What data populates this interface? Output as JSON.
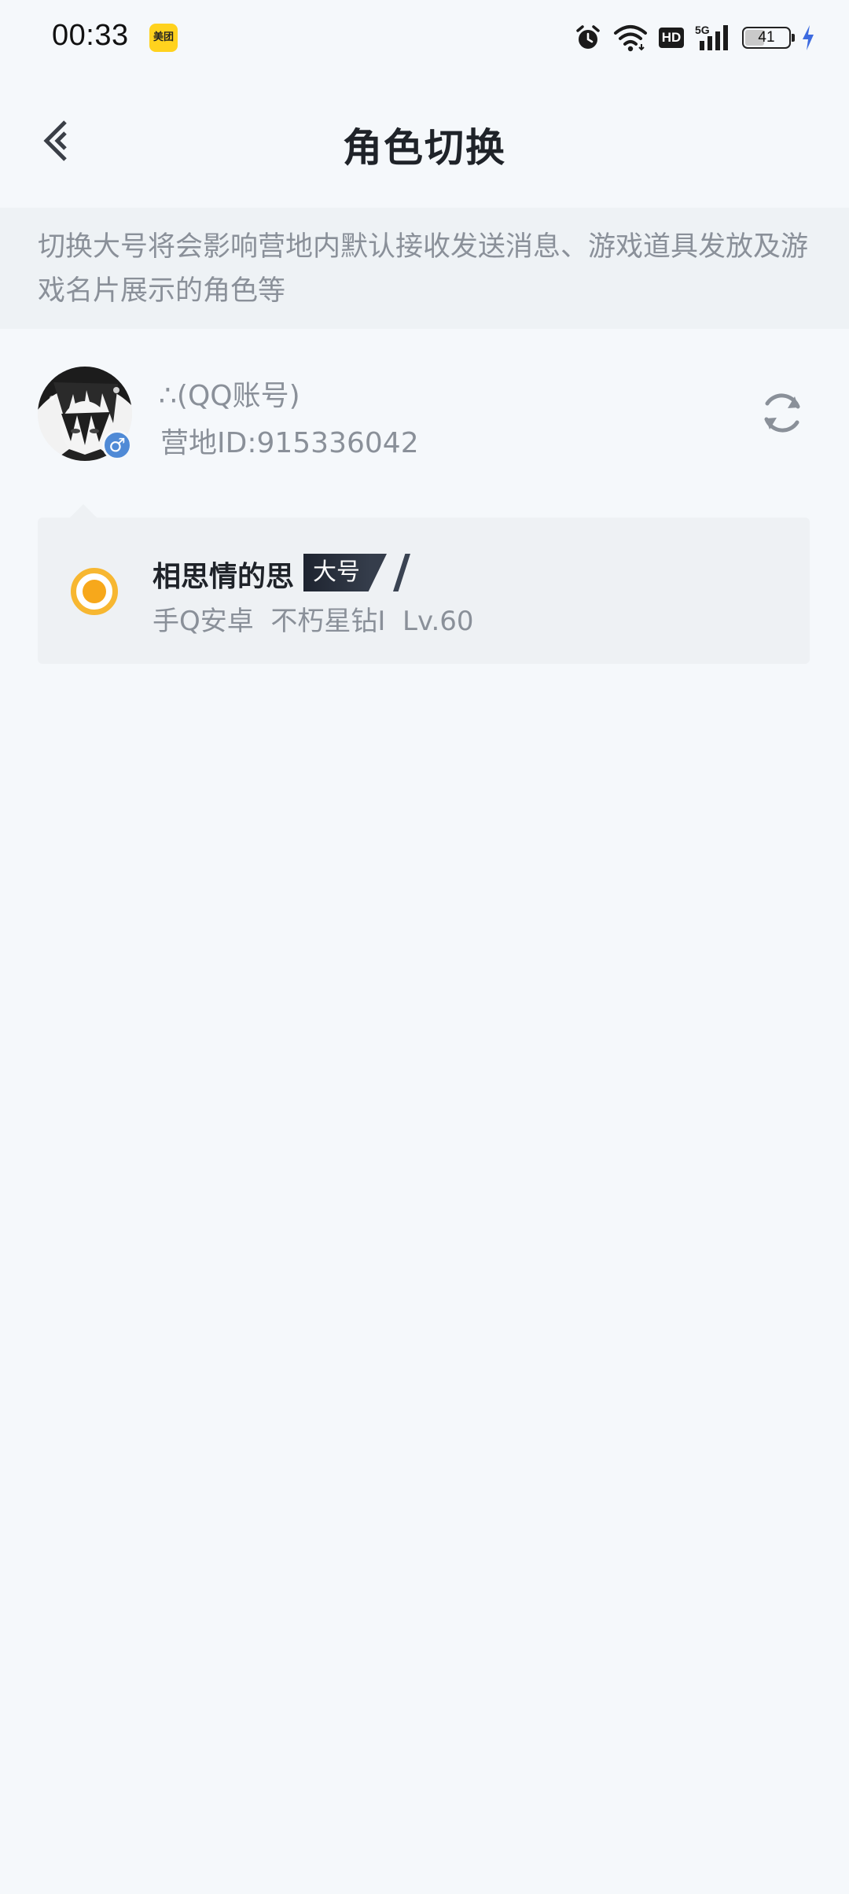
{
  "status_bar": {
    "time": "00:33",
    "app_badge": "美团",
    "network": "5G",
    "hd_label": "HD",
    "battery": "41",
    "battery_level": 0.41
  },
  "header": {
    "title": "角色切换"
  },
  "notice": {
    "text": "切换大号将会影响营地内默认接收发送消息、游戏道具发放及游戏名片展示的角色等"
  },
  "account": {
    "name": "∴(QQ账号)",
    "camp_id": "营地ID:915336042",
    "gender": "♂"
  },
  "roles": [
    {
      "name": "相思情的思",
      "tag": "大号",
      "info": "手Q安卓  不朽星钻I  Lv.60",
      "selected": true
    }
  ],
  "colors": {
    "accent": "#f7b731",
    "background": "#f5f8fb",
    "notice_bg": "#eef2f5",
    "gender_badge": "#4f8ad6"
  }
}
